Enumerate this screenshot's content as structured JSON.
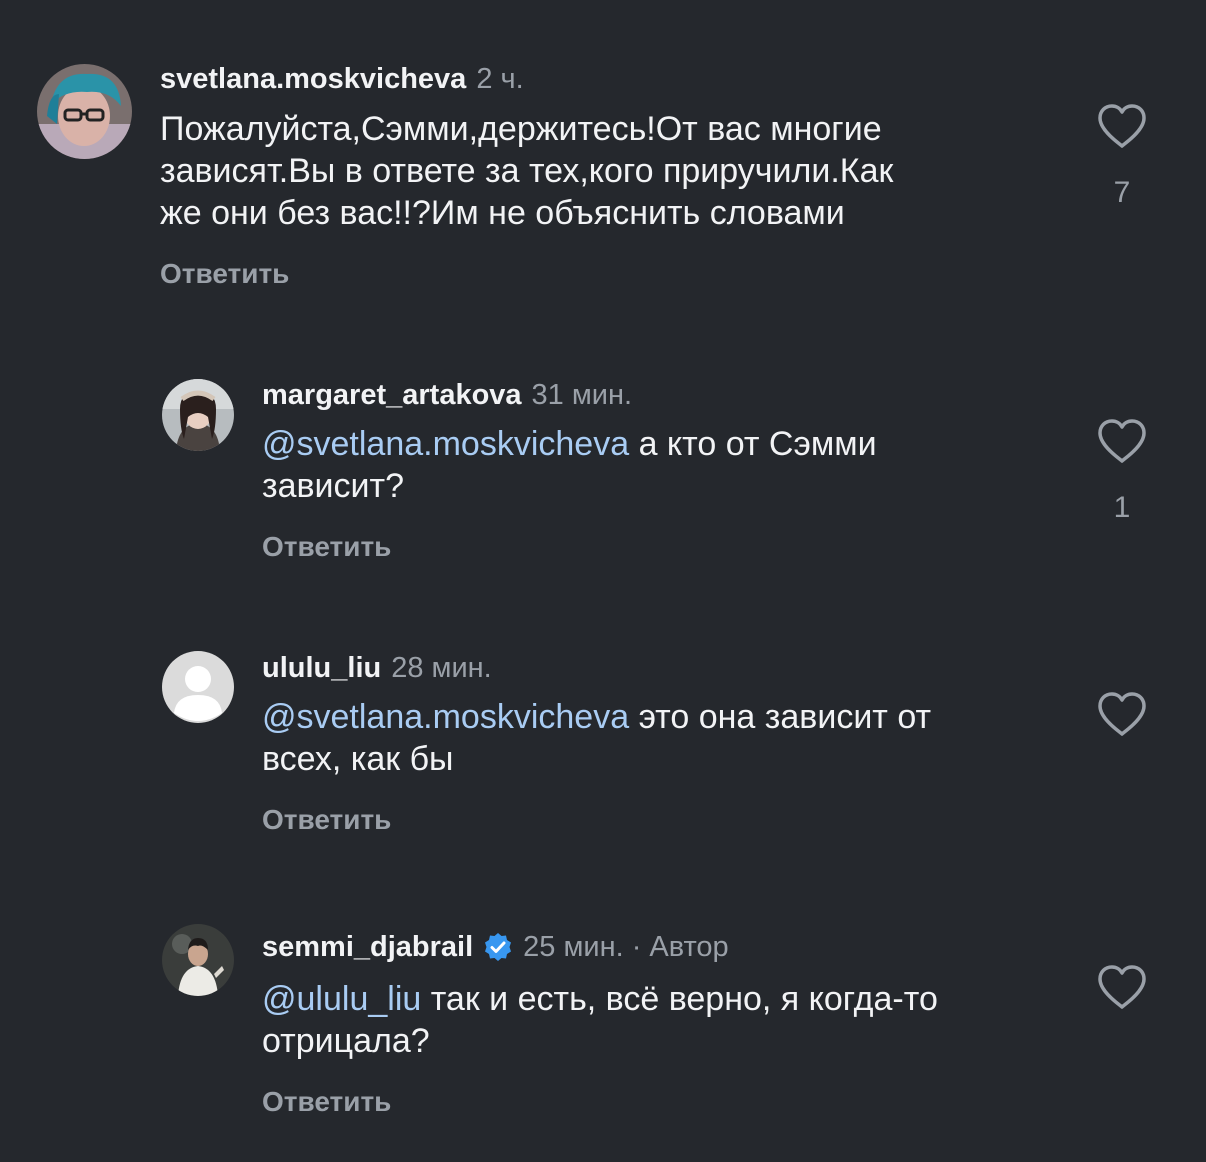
{
  "comments": [
    {
      "username": "svetlana.moskvicheva",
      "time": "2 ч.",
      "text_lines": [
        "Пожалуйста,Сэмми,держитесь!От вас многие",
        "зависят.Вы в ответе за тех,кого приручили.Как",
        "же они без вас!!?Им не объяснить словами"
      ],
      "reply_label": "Ответить",
      "like_count": "7",
      "avatar_icon": "user-avatar-photo"
    },
    {
      "username": "margaret_artakova",
      "time": "31 мин.",
      "mention": "@svetlana.moskvicheva",
      "text_first": " а кто от Сэмми",
      "text_second": "зависит?",
      "reply_label": "Ответить",
      "like_count": "1",
      "avatar_icon": "user-avatar-photo"
    },
    {
      "username": "ululu_liu",
      "time": "28 мин.",
      "mention": "@svetlana.moskvicheva",
      "text_first": " это она зависит от",
      "text_second": "всех, как бы",
      "reply_label": "Ответить",
      "avatar_icon": "default-avatar-icon"
    },
    {
      "username": "semmi_djabrail",
      "time": "25 мин.",
      "separator": "·",
      "author_label": "Автор",
      "mention": "@ululu_liu",
      "text_first": " так и есть, всё верно, я когда-то",
      "text_second": "отрицала?",
      "reply_label": "Ответить",
      "avatar_icon": "user-avatar-photo",
      "badge_icon": "verified-badge-icon"
    }
  ],
  "colors": {
    "background": "#25282d",
    "mention": "#a9ccf3",
    "muted": "#9aa0a8",
    "verified": "#3897f0"
  }
}
